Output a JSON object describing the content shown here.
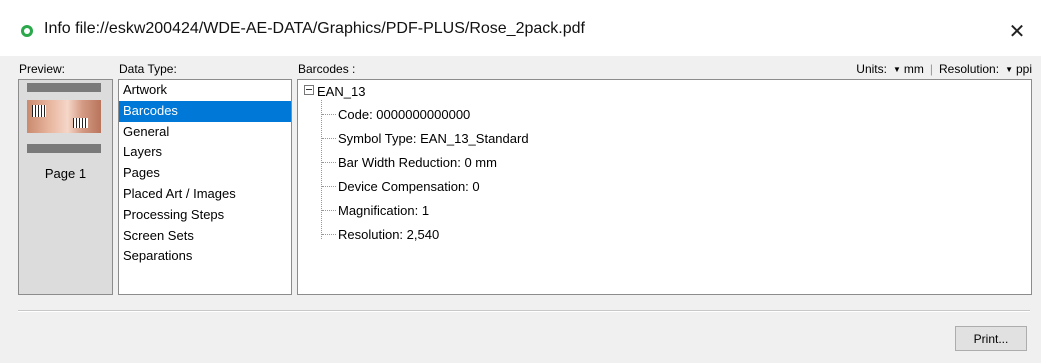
{
  "window": {
    "title": "Info file://eskw200424/WDE-AE-DATA/Graphics/PDF-PLUS/Rose_2pack.pdf",
    "close_label": "✕"
  },
  "labels": {
    "preview": "Preview:",
    "data_type": "Data Type:",
    "barcodes": "Barcodes :"
  },
  "units_bar": {
    "units_label": "Units:",
    "units_value": "mm",
    "separator": "|",
    "resolution_label": "Resolution:",
    "resolution_value": "ppi"
  },
  "preview": {
    "page_label": "Page 1"
  },
  "data_types": {
    "selected_index": 1,
    "items": [
      "Artwork",
      "Barcodes",
      "General",
      "Layers",
      "Pages",
      "Placed Art / Images",
      "Processing Steps",
      "Screen Sets",
      "Separations"
    ]
  },
  "barcodes": {
    "root": "EAN_13",
    "properties": [
      "Code:  0000000000000",
      "Symbol Type: EAN_13_Standard",
      "Bar Width Reduction:  0 mm",
      "Device Compensation: 0",
      "Magnification: 1",
      "Resolution:  2,540"
    ]
  },
  "footer": {
    "print_label": "Print..."
  },
  "colors": {
    "selection": "#0078d7",
    "status_icon": "#2aa84a"
  }
}
